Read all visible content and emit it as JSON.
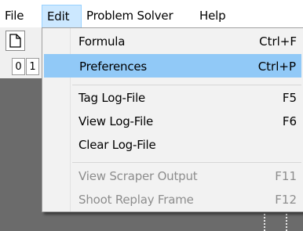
{
  "menubar": {
    "items": [
      {
        "label": "File"
      },
      {
        "label": "Edit"
      },
      {
        "label": "Problem Solver"
      },
      {
        "label": "Help"
      }
    ]
  },
  "toolbar": {
    "new_button_icon": "new-file-icon"
  },
  "tabs": [
    "0",
    "1"
  ],
  "edit_menu": {
    "items": [
      {
        "label": "Formula",
        "shortcut": "Ctrl+F",
        "enabled": true
      },
      {
        "label": "Preferences",
        "shortcut": "Ctrl+P",
        "enabled": true,
        "highlighted": true
      },
      {
        "label": "Tag Log-File",
        "shortcut": "F5",
        "enabled": true
      },
      {
        "label": "View Log-File",
        "shortcut": "F6",
        "enabled": true
      },
      {
        "label": "Clear Log-File",
        "shortcut": "",
        "enabled": true
      },
      {
        "label": "View Scraper Output",
        "shortcut": "F11",
        "enabled": false
      },
      {
        "label": "Shoot Replay Frame",
        "shortcut": "F12",
        "enabled": false
      }
    ]
  },
  "colors": {
    "highlight": "#91c9f7",
    "menu_active": "#cce8ff",
    "workspace": "#6b6b6b"
  }
}
